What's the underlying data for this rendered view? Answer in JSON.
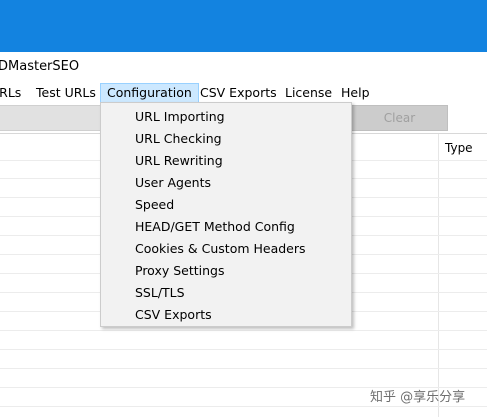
{
  "window": {
    "title": "DMasterSEO"
  },
  "menubar": {
    "items": [
      {
        "label": "URLs"
      },
      {
        "label": "Test URLs"
      },
      {
        "label": "Configuration"
      },
      {
        "label": "CSV Exports"
      },
      {
        "label": "License"
      },
      {
        "label": "Help"
      }
    ]
  },
  "toolbar": {
    "clear_label": "Clear"
  },
  "grid": {
    "type_header": "Type"
  },
  "configuration_menu": {
    "items": [
      {
        "label": "URL Importing"
      },
      {
        "label": "URL Checking"
      },
      {
        "label": "URL Rewriting"
      },
      {
        "label": "User Agents"
      },
      {
        "label": "Speed"
      },
      {
        "label": "HEAD/GET Method Config"
      },
      {
        "label": "Cookies & Custom Headers"
      },
      {
        "label": "Proxy Settings"
      },
      {
        "label": "SSL/TLS"
      },
      {
        "label": "CSV Exports"
      }
    ]
  },
  "watermark": {
    "text": "知乎 @享乐分享"
  },
  "colors": {
    "desktop_blue": "#1383e0",
    "menu_highlight": "#cce8ff",
    "menu_highlight_border": "#99d1ff",
    "dropdown_bg": "#f2f2f2"
  }
}
